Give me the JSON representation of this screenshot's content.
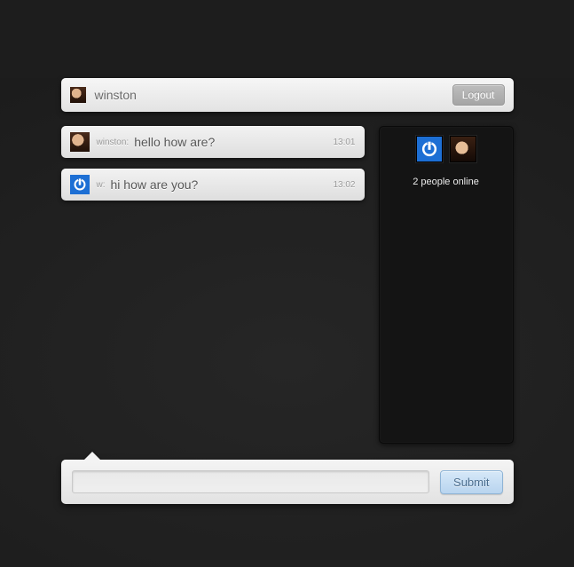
{
  "header": {
    "username": "winston",
    "logout_label": "Logout"
  },
  "messages": [
    {
      "sender": "winston:",
      "text": "hello how are?",
      "time": "13:01",
      "avatar": "winston"
    },
    {
      "sender": "w:",
      "text": "hi how are you?",
      "time": "13:02",
      "avatar": "power"
    }
  ],
  "sidebar": {
    "presence_text": "2 people online",
    "avatars": [
      "power",
      "winston"
    ]
  },
  "composer": {
    "submit_label": "Submit",
    "input_value": ""
  }
}
